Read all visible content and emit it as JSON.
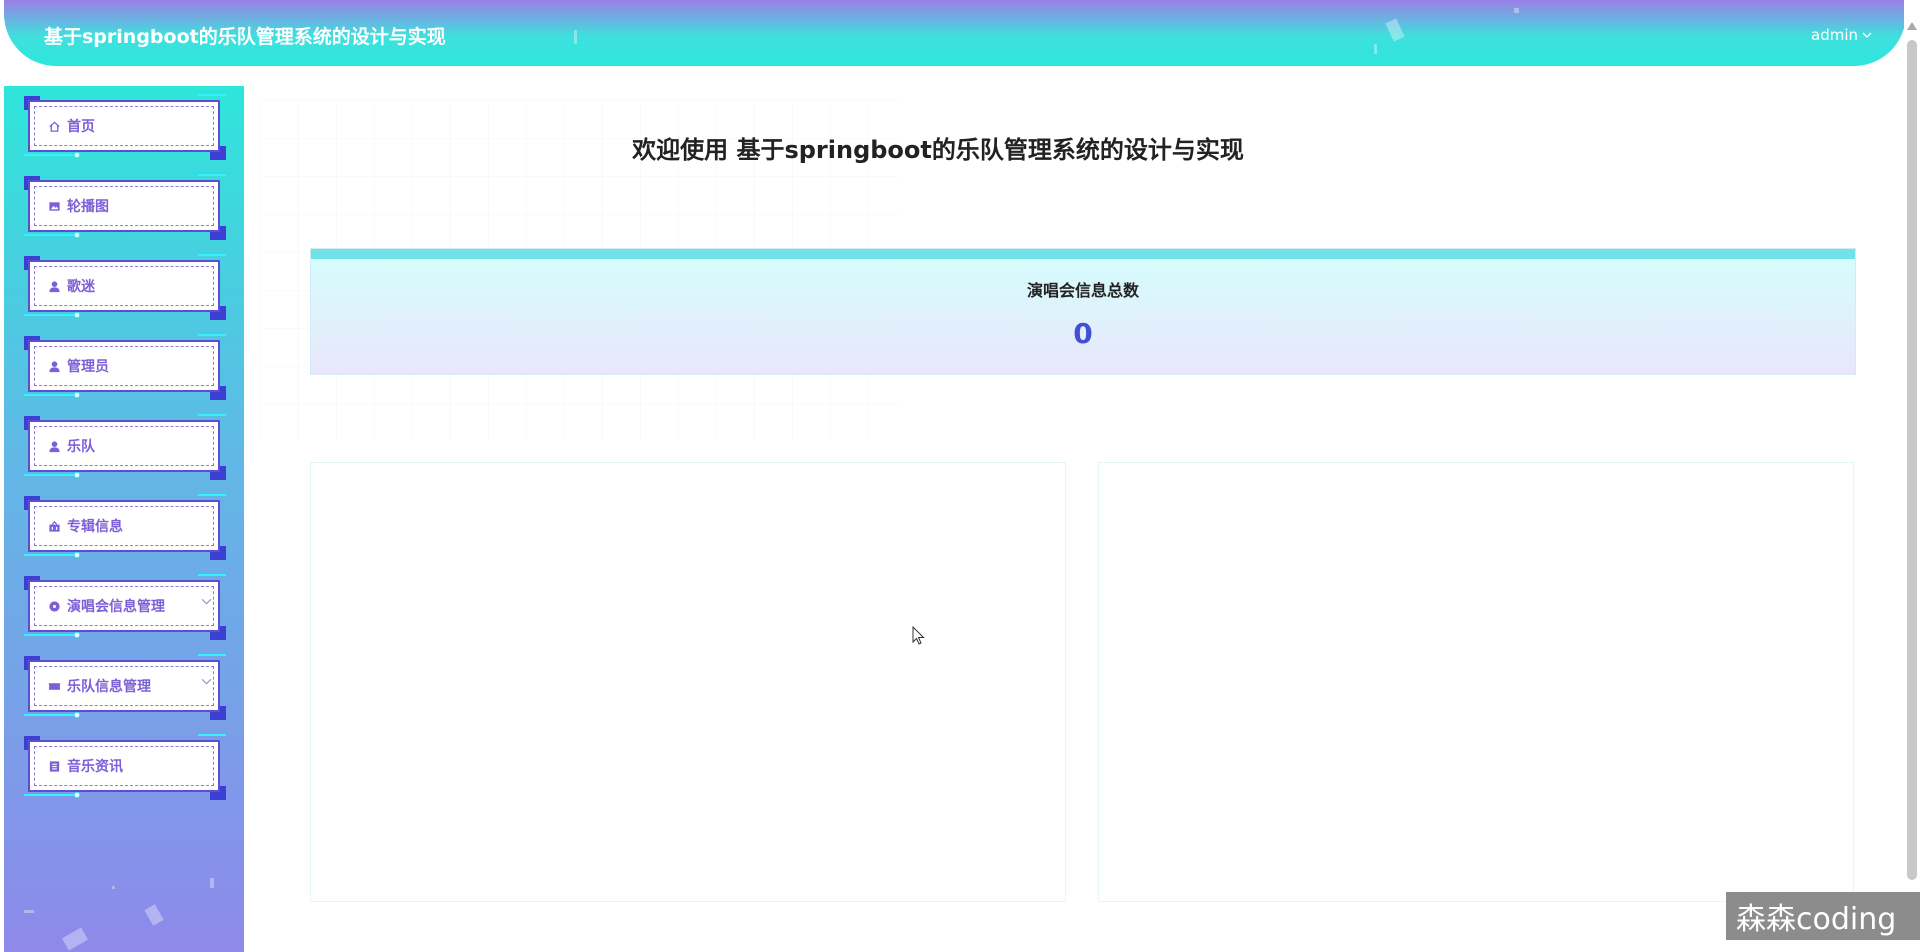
{
  "header": {
    "title": "基于springboot的乐队管理系统的设计与实现",
    "user": "admin",
    "user_chevron": "chevron-down-icon"
  },
  "sidebar": {
    "items": [
      {
        "label": "首页",
        "icon": "home-icon",
        "has_submenu": false
      },
      {
        "label": "轮播图",
        "icon": "image-icon",
        "has_submenu": false
      },
      {
        "label": "歌迷",
        "icon": "user-icon",
        "has_submenu": false
      },
      {
        "label": "管理员",
        "icon": "user-icon",
        "has_submenu": false
      },
      {
        "label": "乐队",
        "icon": "user-icon",
        "has_submenu": false
      },
      {
        "label": "专辑信息",
        "icon": "basket-icon",
        "has_submenu": false
      },
      {
        "label": "演唱会信息管理",
        "icon": "circle-icon",
        "has_submenu": true
      },
      {
        "label": "乐队信息管理",
        "icon": "ticket-icon",
        "has_submenu": true
      },
      {
        "label": "音乐资讯",
        "icon": "document-icon",
        "has_submenu": false
      }
    ]
  },
  "main": {
    "welcome": "欢迎使用 基于springboot的乐队管理系统的设计与实现",
    "stat": {
      "label": "演唱会信息总数",
      "value": "0"
    }
  },
  "watermark": "森森coding",
  "colors": {
    "accent": "#3f4fd6",
    "menu_text": "#7d5fd8",
    "header_top": "#9a7fe6",
    "header_bottom": "#2ce6dc"
  }
}
